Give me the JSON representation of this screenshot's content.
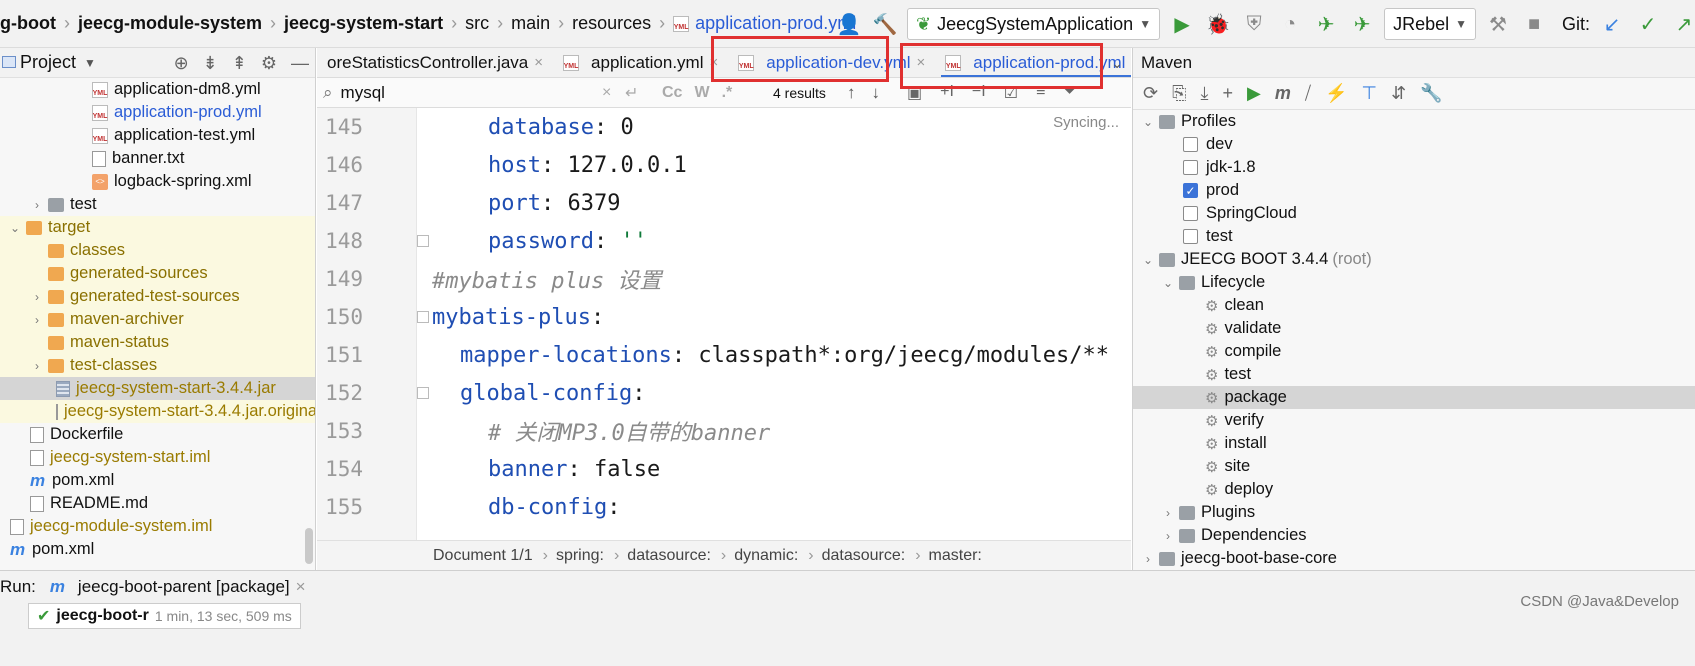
{
  "navbar": {
    "crumbs": [
      "g-boot",
      "jeecg-module-system",
      "jeecg-system-start",
      "src",
      "main",
      "resources",
      "application-prod.yml"
    ],
    "run_config": "JeecgSystemApplication",
    "jrebel": "JRebel",
    "git_label": "Git:"
  },
  "project": {
    "title": "Project",
    "items": [
      "application-dm8.yml",
      "application-prod.yml",
      "application-test.yml",
      "banner.txt",
      "logback-spring.xml",
      "test",
      "target",
      "classes",
      "generated-sources",
      "generated-test-sources",
      "maven-archiver",
      "maven-status",
      "test-classes",
      "jeecg-system-start-3.4.4.jar",
      "jeecg-system-start-3.4.4.jar.origina",
      "Dockerfile",
      "jeecg-system-start.iml",
      "pom.xml",
      "README.md",
      "jeecg-module-system.iml",
      "pom.xml"
    ]
  },
  "editor": {
    "tabs": [
      {
        "label": "oreStatisticsController.java"
      },
      {
        "label": "application.yml"
      },
      {
        "label": "application-dev.yml"
      },
      {
        "label": "application-prod.yml"
      }
    ],
    "search": {
      "query": "mysql",
      "results": "4 results"
    },
    "syncing": "Syncing...",
    "lines": [
      {
        "num": "145",
        "indent": 2,
        "key": "database",
        "sep": ": ",
        "value": "0",
        "kind": "kv"
      },
      {
        "num": "146",
        "indent": 2,
        "key": "host",
        "sep": ": ",
        "value": "127.0.0.1",
        "kind": "kv"
      },
      {
        "num": "147",
        "indent": 2,
        "key": "port",
        "sep": ": ",
        "value": "6379",
        "kind": "kv"
      },
      {
        "num": "148",
        "indent": 2,
        "key": "password",
        "sep": ": ",
        "value": "''",
        "kind": "kvs"
      },
      {
        "num": "149",
        "indent": 0,
        "text": "#mybatis plus 设置",
        "kind": "comment"
      },
      {
        "num": "150",
        "indent": 0,
        "key": "mybatis-plus",
        "sep": ":",
        "value": "",
        "kind": "kv"
      },
      {
        "num": "151",
        "indent": 1,
        "key": "mapper-locations",
        "sep": ": ",
        "value": "classpath*:org/jeecg/modules/**",
        "kind": "kv"
      },
      {
        "num": "152",
        "indent": 1,
        "key": "global-config",
        "sep": ":",
        "value": "",
        "kind": "kv"
      },
      {
        "num": "153",
        "indent": 2,
        "text": "# 关闭MP3.0自带的banner",
        "kind": "comment"
      },
      {
        "num": "154",
        "indent": 2,
        "key": "banner",
        "sep": ": ",
        "value": "false",
        "kind": "kv"
      },
      {
        "num": "155",
        "indent": 2,
        "key": "db-config",
        "sep": ":",
        "value": "",
        "kind": "kv"
      }
    ],
    "breadcrumb": [
      "Document 1/1",
      "spring:",
      "datasource:",
      "dynamic:",
      "datasource:",
      "master:"
    ]
  },
  "maven": {
    "title": "Maven",
    "profiles_label": "Profiles",
    "profiles": [
      {
        "name": "dev",
        "checked": false
      },
      {
        "name": "jdk-1.8",
        "checked": false
      },
      {
        "name": "prod",
        "checked": true
      },
      {
        "name": "SpringCloud",
        "checked": false
      },
      {
        "name": "test",
        "checked": false
      }
    ],
    "project_name": "JEECG BOOT 3.4.4",
    "project_tag": "(root)",
    "lifecycle_label": "Lifecycle",
    "lifecycle": [
      "clean",
      "validate",
      "compile",
      "test",
      "package",
      "verify",
      "install",
      "site",
      "deploy"
    ],
    "plugins_label": "Plugins",
    "dependencies_label": "Dependencies",
    "next_module": "jeecg-boot-base-core"
  },
  "run": {
    "label": "Run:",
    "tab": "jeecg-boot-parent [package]",
    "sub_label": "jeecg-boot-r",
    "sub_time": "1 min, 13 sec, 509 ms"
  },
  "watermark": "CSDN @Java&Develop",
  "colors": {
    "accent": "#3b73d8",
    "highlight_box": "#e03030",
    "yaml_key": "#1f4eb3"
  }
}
